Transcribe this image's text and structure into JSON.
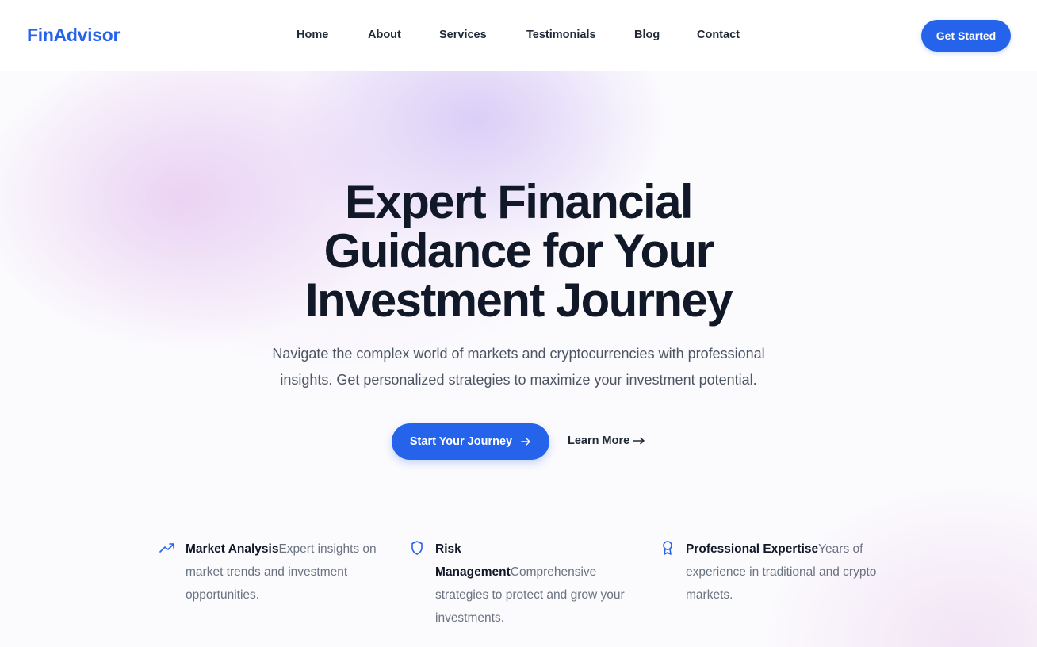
{
  "brand": {
    "name": "FinAdvisor",
    "accent": "#2563eb"
  },
  "nav": {
    "items": [
      {
        "id": "home",
        "label": "Home"
      },
      {
        "id": "about",
        "label": "About"
      },
      {
        "id": "services",
        "label": "Services"
      },
      {
        "id": "testimonials",
        "label": "Testimonials"
      },
      {
        "id": "blog",
        "label": "Blog"
      },
      {
        "id": "contact",
        "label": "Contact"
      }
    ],
    "cta_label": "Get Started"
  },
  "hero": {
    "title_line1": "Expert Financial",
    "title_line2": "Guidance for Your",
    "title_line3": "Investment Journey",
    "subtitle_line1": "Navigate the complex world of markets and cryptocurrencies with professional",
    "subtitle_line2": "insights. Get personalized strategies to maximize your investment potential.",
    "primary_button": {
      "label": "Start Your Journey",
      "icon": "arrow-right-icon"
    },
    "secondary_button": {
      "label": "Learn More",
      "icon": "arrow-right-icon"
    }
  },
  "features": [
    {
      "icon": "trending-up-icon",
      "title": "Market Analysis",
      "description": "Expert insights on market trends and investment opportunities."
    },
    {
      "icon": "shield-icon",
      "title": "Risk Management",
      "description": "Comprehensive strategies to protect and grow your investments."
    },
    {
      "icon": "award-icon",
      "title": "Professional Expertise",
      "description": "Years of experience in traditional and crypto markets."
    }
  ]
}
